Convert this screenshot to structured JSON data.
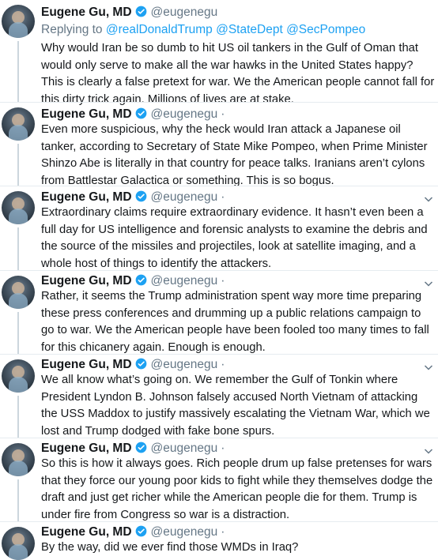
{
  "author": {
    "name": "Eugene Gu, MD",
    "handle": "@eugenegu",
    "dot": "·"
  },
  "reply": {
    "prefix": "Replying to",
    "mentions": [
      "@realDonaldTrump",
      "@StateDept",
      "@SecPompeo"
    ]
  },
  "tweets": [
    {
      "text": "Why would Iran be so dumb to hit US oil tankers in the Gulf of Oman that would only serve to make all the war hawks in the United States happy? This is clearly a false pretext for war. We the American people cannot fall for this dirty trick again. Millions of lives are at stake."
    },
    {
      "text": "Even more suspicious, why the heck would Iran attack a Japanese oil tanker, according to Secretary of State Mike Pompeo, when Prime Minister Shinzo Abe is literally in that country for peace talks. Iranians aren’t cylons from Battlestar Galactica or something. This is so bogus."
    },
    {
      "text": "Extraordinary claims require extraordinary evidence. It hasn’t even been a full day for US intelligence and forensic analysts to examine the debris and the source of the missiles and projectiles, look at satellite imaging, and a whole host of things to identify the attackers."
    },
    {
      "text": "Rather, it seems the Trump administration spent way more time preparing these press conferences and drumming up a public relations campaign to go to war. We the American people have been fooled too many times to fall for this chicanery again. Enough is enough."
    },
    {
      "text": "We all know what’s going on. We remember the Gulf of Tonkin where President Lyndon B. Johnson falsely accused North Vietnam of attacking the USS Maddox to justify massively escalating the Vietnam War, which we lost and Trump dodged with fake bone spurs."
    },
    {
      "text": "So this is how it always goes. Rich people drum up false pretenses for wars that they force our young poor kids to fight while they themselves dodge the draft and just get richer while the American people die for them. Trump is under fire from Congress so war is a distraction."
    },
    {
      "text": "By the way, did we ever find those WMDs in Iraq?"
    }
  ]
}
